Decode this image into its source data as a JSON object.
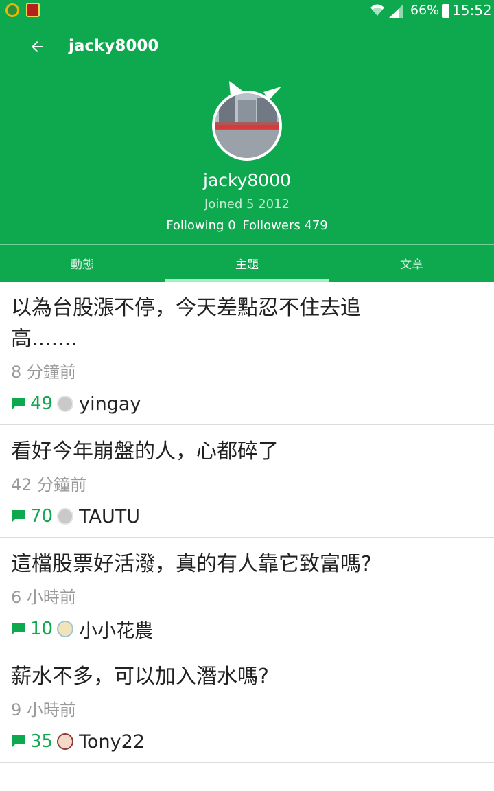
{
  "status_bar": {
    "battery": "66%",
    "time": "15:52",
    "icons": [
      "app-notification-icon",
      "app-notification-icon-2",
      "wifi-icon",
      "signal-icon",
      "battery-icon"
    ]
  },
  "toolbar": {
    "title": "jacky8000",
    "back_icon": "arrow-left-icon"
  },
  "profile": {
    "name": "jacky8000",
    "joined": "Joined 5 2012",
    "following": "Following 0",
    "followers": "Followers 479"
  },
  "tabs": [
    {
      "label": "動態",
      "active": false
    },
    {
      "label": "主題",
      "active": true
    },
    {
      "label": "文章",
      "active": false
    }
  ],
  "posts": [
    {
      "title": "以為台股漲不停，今天差點忍不住去追高.......",
      "time": "8 分鐘前",
      "comments": "49",
      "user": "yingay"
    },
    {
      "title": "看好今年崩盤的人，心都碎了",
      "time": "42 分鐘前",
      "comments": "70",
      "user": "TAUTU"
    },
    {
      "title": "這檔股票好活潑，真的有人靠它致富嗎?",
      "time": "6 小時前",
      "comments": "10",
      "user": "小小花農"
    },
    {
      "title": "薪水不多，可以加入潛水嗎?",
      "time": "9 小時前",
      "comments": "35",
      "user": "Tony22"
    }
  ],
  "colors": {
    "brand_green": "#0ea94e",
    "text_dark": "#222222",
    "text_muted": "#9a9a9a"
  }
}
